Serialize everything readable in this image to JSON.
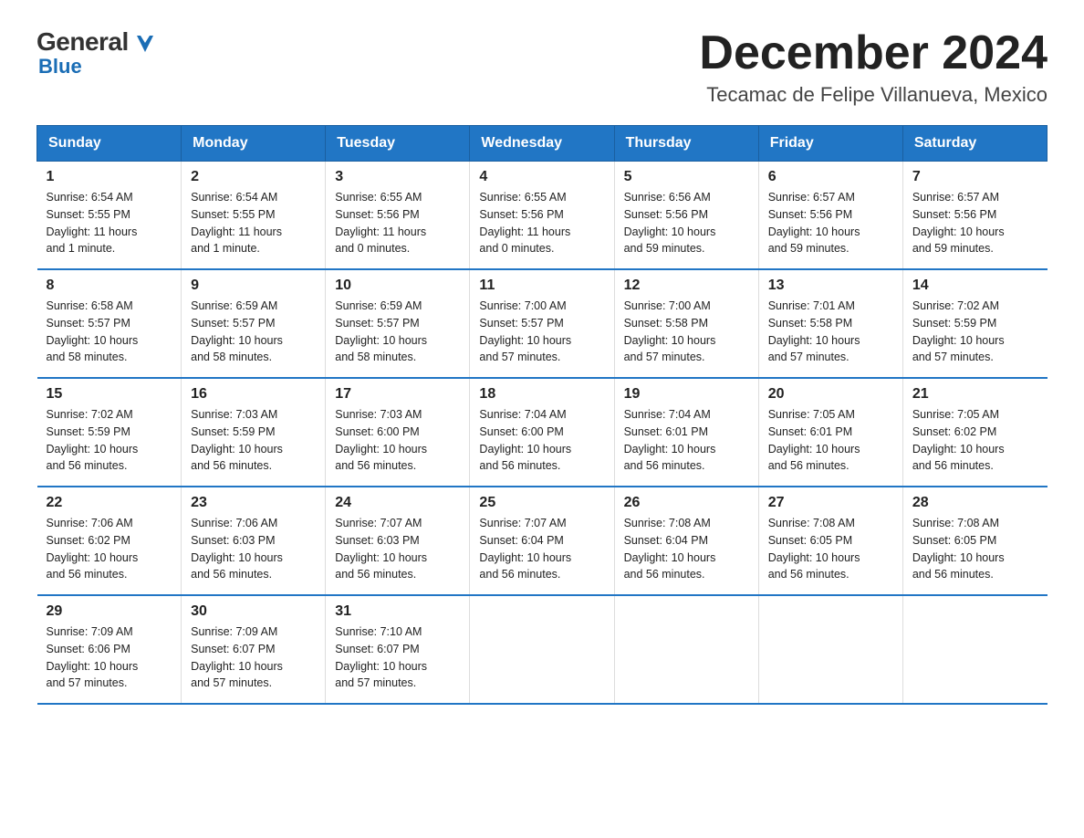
{
  "header": {
    "logo_general": "General",
    "logo_blue": "Blue",
    "month_title": "December 2024",
    "location": "Tecamac de Felipe Villanueva, Mexico"
  },
  "weekdays": [
    "Sunday",
    "Monday",
    "Tuesday",
    "Wednesday",
    "Thursday",
    "Friday",
    "Saturday"
  ],
  "weeks": [
    [
      {
        "day": "1",
        "sunrise": "6:54 AM",
        "sunset": "5:55 PM",
        "daylight": "11 hours and 1 minute."
      },
      {
        "day": "2",
        "sunrise": "6:54 AM",
        "sunset": "5:55 PM",
        "daylight": "11 hours and 1 minute."
      },
      {
        "day": "3",
        "sunrise": "6:55 AM",
        "sunset": "5:56 PM",
        "daylight": "11 hours and 0 minutes."
      },
      {
        "day": "4",
        "sunrise": "6:55 AM",
        "sunset": "5:56 PM",
        "daylight": "11 hours and 0 minutes."
      },
      {
        "day": "5",
        "sunrise": "6:56 AM",
        "sunset": "5:56 PM",
        "daylight": "10 hours and 59 minutes."
      },
      {
        "day": "6",
        "sunrise": "6:57 AM",
        "sunset": "5:56 PM",
        "daylight": "10 hours and 59 minutes."
      },
      {
        "day": "7",
        "sunrise": "6:57 AM",
        "sunset": "5:56 PM",
        "daylight": "10 hours and 59 minutes."
      }
    ],
    [
      {
        "day": "8",
        "sunrise": "6:58 AM",
        "sunset": "5:57 PM",
        "daylight": "10 hours and 58 minutes."
      },
      {
        "day": "9",
        "sunrise": "6:59 AM",
        "sunset": "5:57 PM",
        "daylight": "10 hours and 58 minutes."
      },
      {
        "day": "10",
        "sunrise": "6:59 AM",
        "sunset": "5:57 PM",
        "daylight": "10 hours and 58 minutes."
      },
      {
        "day": "11",
        "sunrise": "7:00 AM",
        "sunset": "5:57 PM",
        "daylight": "10 hours and 57 minutes."
      },
      {
        "day": "12",
        "sunrise": "7:00 AM",
        "sunset": "5:58 PM",
        "daylight": "10 hours and 57 minutes."
      },
      {
        "day": "13",
        "sunrise": "7:01 AM",
        "sunset": "5:58 PM",
        "daylight": "10 hours and 57 minutes."
      },
      {
        "day": "14",
        "sunrise": "7:02 AM",
        "sunset": "5:59 PM",
        "daylight": "10 hours and 57 minutes."
      }
    ],
    [
      {
        "day": "15",
        "sunrise": "7:02 AM",
        "sunset": "5:59 PM",
        "daylight": "10 hours and 56 minutes."
      },
      {
        "day": "16",
        "sunrise": "7:03 AM",
        "sunset": "5:59 PM",
        "daylight": "10 hours and 56 minutes."
      },
      {
        "day": "17",
        "sunrise": "7:03 AM",
        "sunset": "6:00 PM",
        "daylight": "10 hours and 56 minutes."
      },
      {
        "day": "18",
        "sunrise": "7:04 AM",
        "sunset": "6:00 PM",
        "daylight": "10 hours and 56 minutes."
      },
      {
        "day": "19",
        "sunrise": "7:04 AM",
        "sunset": "6:01 PM",
        "daylight": "10 hours and 56 minutes."
      },
      {
        "day": "20",
        "sunrise": "7:05 AM",
        "sunset": "6:01 PM",
        "daylight": "10 hours and 56 minutes."
      },
      {
        "day": "21",
        "sunrise": "7:05 AM",
        "sunset": "6:02 PM",
        "daylight": "10 hours and 56 minutes."
      }
    ],
    [
      {
        "day": "22",
        "sunrise": "7:06 AM",
        "sunset": "6:02 PM",
        "daylight": "10 hours and 56 minutes."
      },
      {
        "day": "23",
        "sunrise": "7:06 AM",
        "sunset": "6:03 PM",
        "daylight": "10 hours and 56 minutes."
      },
      {
        "day": "24",
        "sunrise": "7:07 AM",
        "sunset": "6:03 PM",
        "daylight": "10 hours and 56 minutes."
      },
      {
        "day": "25",
        "sunrise": "7:07 AM",
        "sunset": "6:04 PM",
        "daylight": "10 hours and 56 minutes."
      },
      {
        "day": "26",
        "sunrise": "7:08 AM",
        "sunset": "6:04 PM",
        "daylight": "10 hours and 56 minutes."
      },
      {
        "day": "27",
        "sunrise": "7:08 AM",
        "sunset": "6:05 PM",
        "daylight": "10 hours and 56 minutes."
      },
      {
        "day": "28",
        "sunrise": "7:08 AM",
        "sunset": "6:05 PM",
        "daylight": "10 hours and 56 minutes."
      }
    ],
    [
      {
        "day": "29",
        "sunrise": "7:09 AM",
        "sunset": "6:06 PM",
        "daylight": "10 hours and 57 minutes."
      },
      {
        "day": "30",
        "sunrise": "7:09 AM",
        "sunset": "6:07 PM",
        "daylight": "10 hours and 57 minutes."
      },
      {
        "day": "31",
        "sunrise": "7:10 AM",
        "sunset": "6:07 PM",
        "daylight": "10 hours and 57 minutes."
      },
      {
        "day": "",
        "sunrise": "",
        "sunset": "",
        "daylight": ""
      },
      {
        "day": "",
        "sunrise": "",
        "sunset": "",
        "daylight": ""
      },
      {
        "day": "",
        "sunrise": "",
        "sunset": "",
        "daylight": ""
      },
      {
        "day": "",
        "sunrise": "",
        "sunset": "",
        "daylight": ""
      }
    ]
  ],
  "labels": {
    "sunrise": "Sunrise:",
    "sunset": "Sunset:",
    "daylight": "Daylight:"
  },
  "colors": {
    "header_bg": "#2176c5",
    "header_text": "#ffffff",
    "border": "#2176c5"
  }
}
